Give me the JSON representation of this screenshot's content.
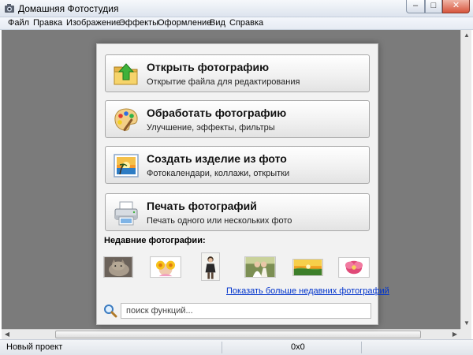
{
  "window": {
    "title": "Домашняя Фотостудия"
  },
  "window_buttons": {
    "minimize": "–",
    "maximize": "□",
    "close": "✕"
  },
  "menu": [
    "Файл",
    "Правка",
    "Изображение",
    "Эффекты",
    "Оформление",
    "Вид",
    "Справка"
  ],
  "actions": [
    {
      "title": "Открыть фотографию",
      "subtitle": "Открытие файла для редактирования",
      "icon": "open-folder-icon"
    },
    {
      "title": "Обработать фотографию",
      "subtitle": "Улучшение, эффекты, фильтры",
      "icon": "palette-icon"
    },
    {
      "title": "Создать изделие из фото",
      "subtitle": "Фотокалендари, коллажи, открытки",
      "icon": "sunset-picture-icon"
    },
    {
      "title": "Печать фотографий",
      "subtitle": "Печать одного или нескольких фото",
      "icon": "printer-icon"
    }
  ],
  "recent": {
    "label": "Недавние фотографии:",
    "photos": [
      "cat-photo",
      "girl-with-flowers-photo",
      "woman-portrait-photo",
      "wedding-couple-photo",
      "sunset-field-photo",
      "pink-flower-photo"
    ],
    "more_link": "Показать больше недавних фотографий"
  },
  "search": {
    "placeholder": "поиск функций..."
  },
  "status": {
    "left": "Новый проект",
    "coordinates": "0x0"
  },
  "colors": {
    "workspace": "#7b7b7b",
    "panel": "#f2f2f2",
    "link": "#0033cc",
    "close_button": "#d7553c"
  }
}
